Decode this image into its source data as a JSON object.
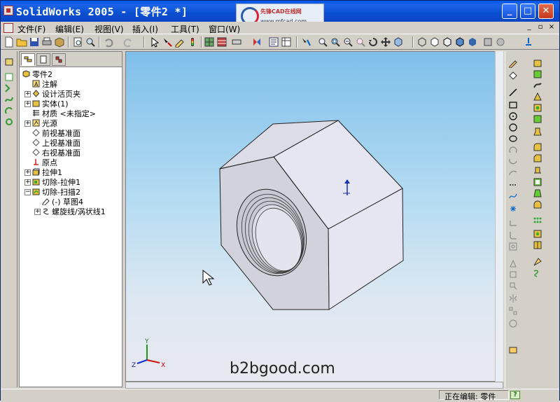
{
  "window": {
    "title": "SolidWorks 2005 - [零件2 *]",
    "logo_brand": "先锋CAD在线网",
    "logo_url": "www.mfcad.com",
    "minimize": "_",
    "maximize": "□",
    "close": "✕"
  },
  "menu": {
    "items": [
      "文件(F)",
      "编辑(E)",
      "视图(V)",
      "插入(I)",
      "工具(T)",
      "窗口(W)"
    ],
    "doc_controls": [
      "_",
      "▫",
      "×"
    ]
  },
  "feature_tree": {
    "nodes": [
      {
        "label": "零件2",
        "icon": "part-icon"
      },
      {
        "label": "注解",
        "icon": "annotation-icon"
      },
      {
        "label": "设计活页夹",
        "icon": "binder-icon"
      },
      {
        "label": "实体(1)",
        "icon": "solid-body-icon"
      },
      {
        "label": "材质 <未指定>",
        "icon": "material-icon"
      },
      {
        "label": "光源",
        "icon": "lighting-icon"
      },
      {
        "label": "前视基准面",
        "icon": "plane-icon"
      },
      {
        "label": "上视基准面",
        "icon": "plane-icon"
      },
      {
        "label": "右视基准面",
        "icon": "plane-icon"
      },
      {
        "label": "原点",
        "icon": "origin-icon"
      },
      {
        "label": "拉伸1",
        "icon": "extrude-icon"
      },
      {
        "label": "切除-拉伸1",
        "icon": "cut-extrude-icon"
      },
      {
        "label": "切除-扫描2",
        "icon": "cut-sweep-icon"
      },
      {
        "label": "(-) 草图4",
        "icon": "sketch-icon"
      },
      {
        "label": "螺旋线/涡状线1",
        "icon": "helix-icon"
      }
    ]
  },
  "viewport": {
    "watermark": "b2bgood.com",
    "triad": {
      "x": "X",
      "y": "Y",
      "z": "Z"
    }
  },
  "status": {
    "text": "正在编辑: 零件",
    "help": "?"
  },
  "colors": {
    "title_bar": "#0a4fd1",
    "viewport_top": "#7fbfea",
    "model_face": "#e2e2ee"
  }
}
